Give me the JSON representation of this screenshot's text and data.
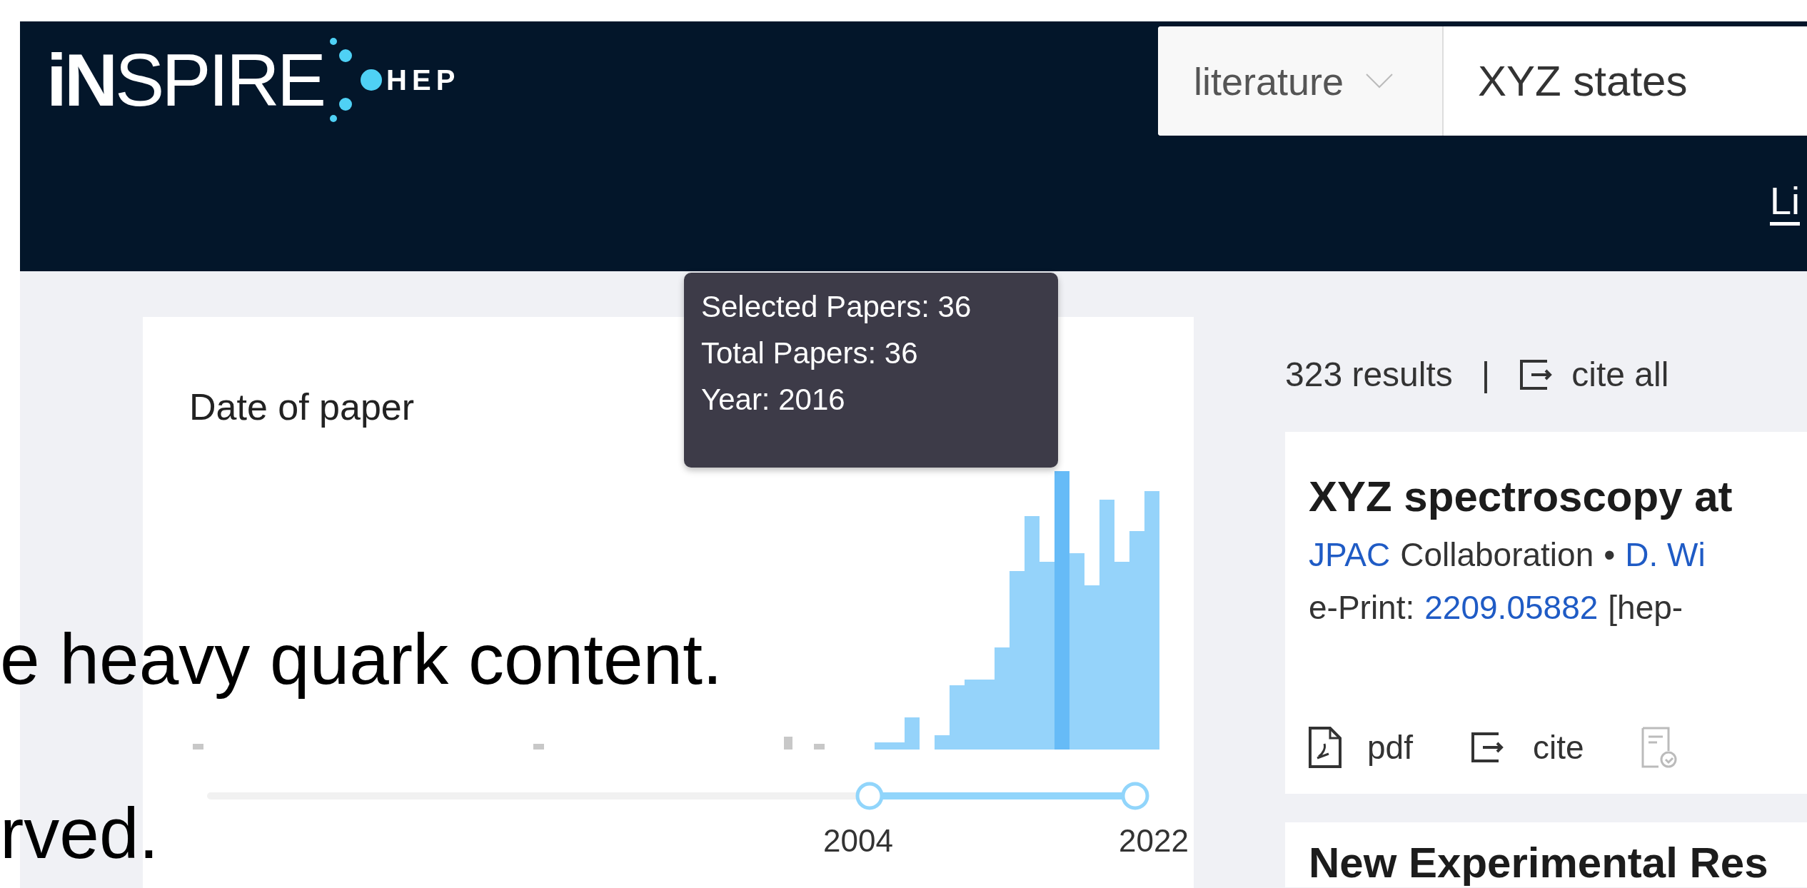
{
  "logo": {
    "wordmark": "**iN**SPIRE",
    "suffix": "HEP"
  },
  "search": {
    "scope": "literature",
    "value": "XYZ states"
  },
  "nav": [
    {
      "label": "Li",
      "selected": true
    }
  ],
  "facet": {
    "title": "Date of paper",
    "range_start": "2004",
    "range_end": "2022"
  },
  "tooltip": {
    "lines": [
      "Selected Papers: 36",
      "Total Papers: 36",
      "Year: 2016"
    ]
  },
  "results": {
    "count": "323 results",
    "separator": "|",
    "cite_all": "cite all"
  },
  "records": [
    {
      "title": "XYZ spectroscopy at",
      "authors": [
        {
          "text": "JPAC",
          "link": true
        },
        {
          "text": "Collaboration",
          "link": false
        },
        {
          "text": "•",
          "link": false
        },
        {
          "text": "D. Wi",
          "link": true
        }
      ],
      "eprint_label": "e-Print:",
      "eprint": "2209.05882",
      "category": "[hep-",
      "actions": [
        {
          "kind": "pdf",
          "label": "pdf",
          "disabled": false
        },
        {
          "kind": "cite",
          "label": "cite",
          "disabled": false
        },
        {
          "kind": "reference",
          "disabled": true
        }
      ]
    },
    {
      "title": "New Experimental Res"
    }
  ],
  "overlay": [
    "e heavy quark content.",
    "rved."
  ]
}
